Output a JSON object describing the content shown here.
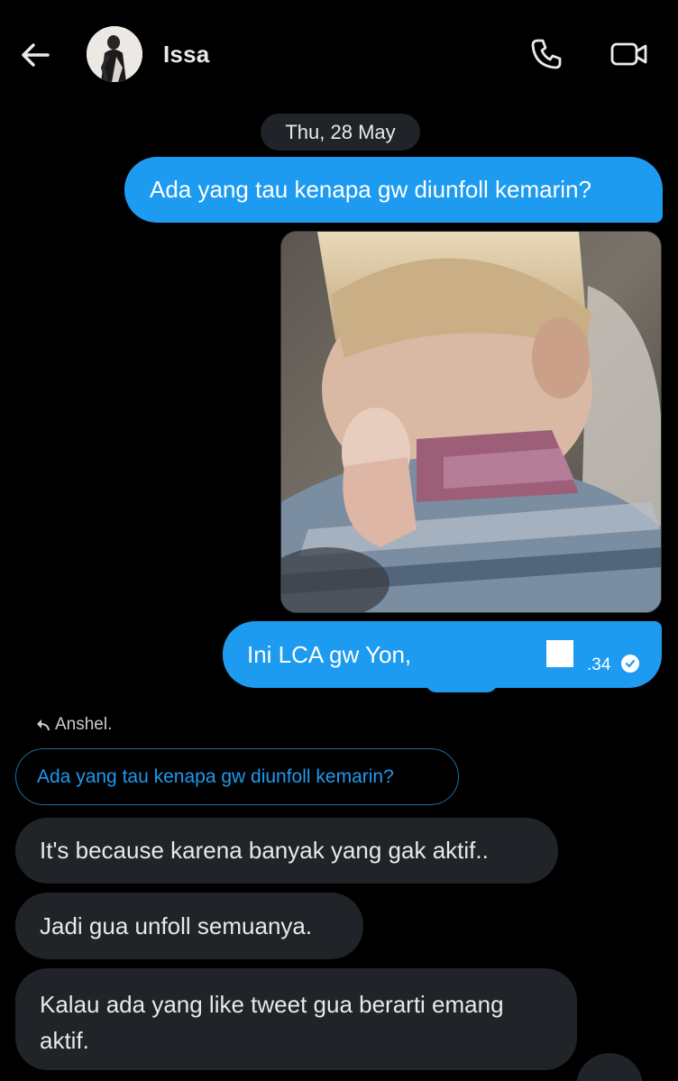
{
  "header": {
    "contact_name": "Issa",
    "icons": {
      "back": "back-arrow-icon",
      "call": "phone-icon",
      "video": "video-camera-icon"
    }
  },
  "conversation": {
    "date_separator": "Thu, 28 May",
    "messages": [
      {
        "direction": "sent",
        "text": "Ada yang tau kenapa gw diunfoll kemarin?"
      },
      {
        "direction": "sent",
        "type": "gif",
        "description_icon": "gif-media"
      },
      {
        "direction": "sent",
        "text": "Ini LCA gw Yon,",
        "time": ".34",
        "status_icon": "read-check-icon"
      }
    ],
    "reply_context": {
      "author": "Anshel.",
      "quoted_text": "Ada yang tau kenapa gw diunfoll kemarin?"
    },
    "received": [
      {
        "text": "It's because karena banyak yang gak aktif.."
      },
      {
        "text": "Jadi gua unfoll semuanya."
      },
      {
        "text": "Kalau ada yang like tweet gua berarti emang aktif."
      }
    ]
  },
  "colors": {
    "background": "#000000",
    "sent_bubble": "#1d9bf0",
    "received_bubble": "#202327",
    "text_primary": "#e7e9ea"
  }
}
